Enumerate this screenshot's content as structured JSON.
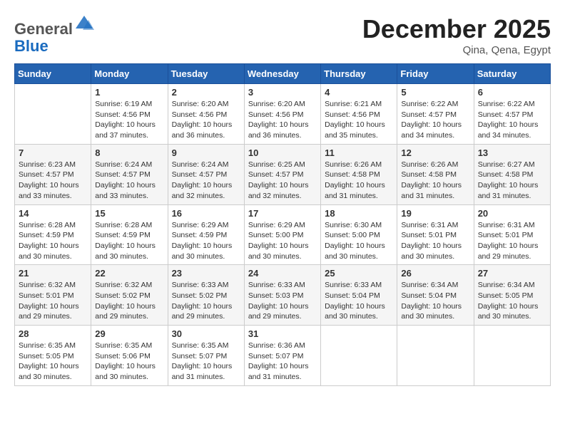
{
  "header": {
    "logo_line1": "General",
    "logo_line2": "Blue",
    "month": "December 2025",
    "location": "Qina, Qena, Egypt"
  },
  "weekdays": [
    "Sunday",
    "Monday",
    "Tuesday",
    "Wednesday",
    "Thursday",
    "Friday",
    "Saturday"
  ],
  "weeks": [
    [
      {
        "day": "",
        "info": ""
      },
      {
        "day": "1",
        "info": "Sunrise: 6:19 AM\nSunset: 4:56 PM\nDaylight: 10 hours\nand 37 minutes."
      },
      {
        "day": "2",
        "info": "Sunrise: 6:20 AM\nSunset: 4:56 PM\nDaylight: 10 hours\nand 36 minutes."
      },
      {
        "day": "3",
        "info": "Sunrise: 6:20 AM\nSunset: 4:56 PM\nDaylight: 10 hours\nand 36 minutes."
      },
      {
        "day": "4",
        "info": "Sunrise: 6:21 AM\nSunset: 4:56 PM\nDaylight: 10 hours\nand 35 minutes."
      },
      {
        "day": "5",
        "info": "Sunrise: 6:22 AM\nSunset: 4:57 PM\nDaylight: 10 hours\nand 34 minutes."
      },
      {
        "day": "6",
        "info": "Sunrise: 6:22 AM\nSunset: 4:57 PM\nDaylight: 10 hours\nand 34 minutes."
      }
    ],
    [
      {
        "day": "7",
        "info": "Sunrise: 6:23 AM\nSunset: 4:57 PM\nDaylight: 10 hours\nand 33 minutes."
      },
      {
        "day": "8",
        "info": "Sunrise: 6:24 AM\nSunset: 4:57 PM\nDaylight: 10 hours\nand 33 minutes."
      },
      {
        "day": "9",
        "info": "Sunrise: 6:24 AM\nSunset: 4:57 PM\nDaylight: 10 hours\nand 32 minutes."
      },
      {
        "day": "10",
        "info": "Sunrise: 6:25 AM\nSunset: 4:57 PM\nDaylight: 10 hours\nand 32 minutes."
      },
      {
        "day": "11",
        "info": "Sunrise: 6:26 AM\nSunset: 4:58 PM\nDaylight: 10 hours\nand 31 minutes."
      },
      {
        "day": "12",
        "info": "Sunrise: 6:26 AM\nSunset: 4:58 PM\nDaylight: 10 hours\nand 31 minutes."
      },
      {
        "day": "13",
        "info": "Sunrise: 6:27 AM\nSunset: 4:58 PM\nDaylight: 10 hours\nand 31 minutes."
      }
    ],
    [
      {
        "day": "14",
        "info": "Sunrise: 6:28 AM\nSunset: 4:59 PM\nDaylight: 10 hours\nand 30 minutes."
      },
      {
        "day": "15",
        "info": "Sunrise: 6:28 AM\nSunset: 4:59 PM\nDaylight: 10 hours\nand 30 minutes."
      },
      {
        "day": "16",
        "info": "Sunrise: 6:29 AM\nSunset: 4:59 PM\nDaylight: 10 hours\nand 30 minutes."
      },
      {
        "day": "17",
        "info": "Sunrise: 6:29 AM\nSunset: 5:00 PM\nDaylight: 10 hours\nand 30 minutes."
      },
      {
        "day": "18",
        "info": "Sunrise: 6:30 AM\nSunset: 5:00 PM\nDaylight: 10 hours\nand 30 minutes."
      },
      {
        "day": "19",
        "info": "Sunrise: 6:31 AM\nSunset: 5:01 PM\nDaylight: 10 hours\nand 30 minutes."
      },
      {
        "day": "20",
        "info": "Sunrise: 6:31 AM\nSunset: 5:01 PM\nDaylight: 10 hours\nand 29 minutes."
      }
    ],
    [
      {
        "day": "21",
        "info": "Sunrise: 6:32 AM\nSunset: 5:01 PM\nDaylight: 10 hours\nand 29 minutes."
      },
      {
        "day": "22",
        "info": "Sunrise: 6:32 AM\nSunset: 5:02 PM\nDaylight: 10 hours\nand 29 minutes."
      },
      {
        "day": "23",
        "info": "Sunrise: 6:33 AM\nSunset: 5:02 PM\nDaylight: 10 hours\nand 29 minutes."
      },
      {
        "day": "24",
        "info": "Sunrise: 6:33 AM\nSunset: 5:03 PM\nDaylight: 10 hours\nand 29 minutes."
      },
      {
        "day": "25",
        "info": "Sunrise: 6:33 AM\nSunset: 5:04 PM\nDaylight: 10 hours\nand 30 minutes."
      },
      {
        "day": "26",
        "info": "Sunrise: 6:34 AM\nSunset: 5:04 PM\nDaylight: 10 hours\nand 30 minutes."
      },
      {
        "day": "27",
        "info": "Sunrise: 6:34 AM\nSunset: 5:05 PM\nDaylight: 10 hours\nand 30 minutes."
      }
    ],
    [
      {
        "day": "28",
        "info": "Sunrise: 6:35 AM\nSunset: 5:05 PM\nDaylight: 10 hours\nand 30 minutes."
      },
      {
        "day": "29",
        "info": "Sunrise: 6:35 AM\nSunset: 5:06 PM\nDaylight: 10 hours\nand 30 minutes."
      },
      {
        "day": "30",
        "info": "Sunrise: 6:35 AM\nSunset: 5:07 PM\nDaylight: 10 hours\nand 31 minutes."
      },
      {
        "day": "31",
        "info": "Sunrise: 6:36 AM\nSunset: 5:07 PM\nDaylight: 10 hours\nand 31 minutes."
      },
      {
        "day": "",
        "info": ""
      },
      {
        "day": "",
        "info": ""
      },
      {
        "day": "",
        "info": ""
      }
    ]
  ]
}
